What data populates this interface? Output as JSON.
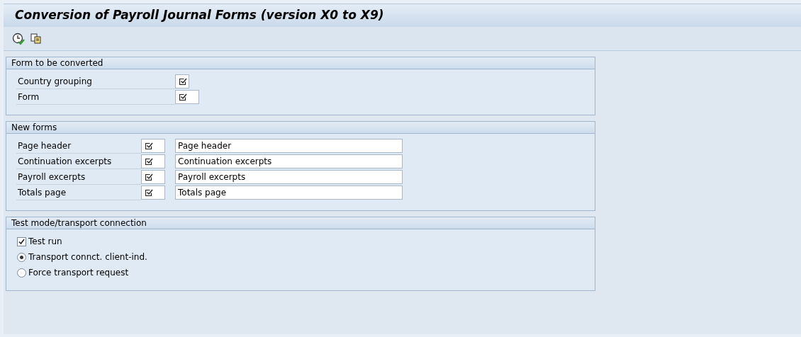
{
  "window": {
    "title": "Conversion of Payroll Journal Forms (version X0 to X9)"
  },
  "groups": [
    {
      "title": "Form to be converted",
      "rows": [
        {
          "label": "Country grouping",
          "kind": "short"
        },
        {
          "label": "Form",
          "kind": "medium"
        }
      ]
    },
    {
      "title": "New forms",
      "rows": [
        {
          "label": "Page header",
          "value": "Page header"
        },
        {
          "label": "Continuation excerpts",
          "value": "Continuation excerpts"
        },
        {
          "label": "Payroll excerpts",
          "value": "Payroll excerpts"
        },
        {
          "label": "Totals page",
          "value": "Totals page"
        }
      ]
    }
  ],
  "options": {
    "title": "Test mode/transport connection",
    "items": [
      {
        "kind": "checkbox",
        "label": "Test run",
        "checked": true
      },
      {
        "kind": "radio",
        "label": "Transport connct. client-ind.",
        "selected": true
      },
      {
        "kind": "radio",
        "label": "Force transport request",
        "selected": false
      }
    ]
  }
}
